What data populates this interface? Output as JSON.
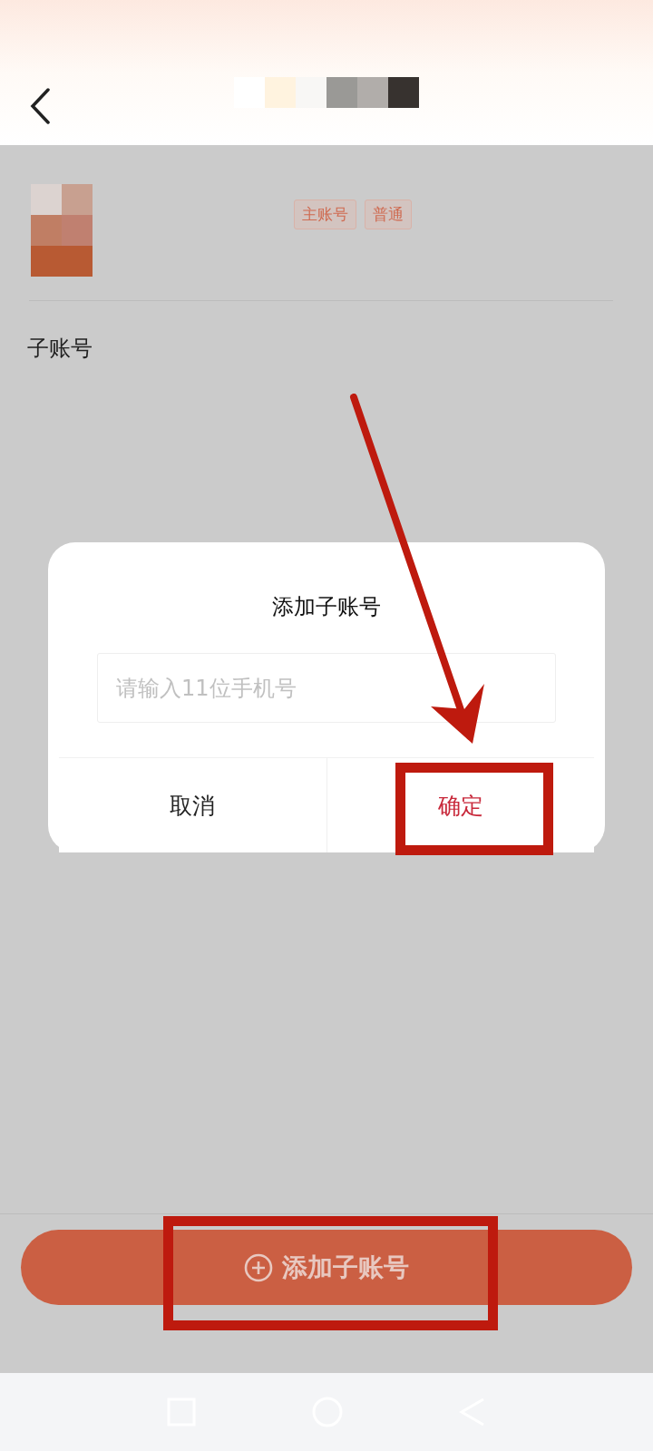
{
  "profile": {
    "tags": [
      "主账号",
      "普通"
    ]
  },
  "section_title": "子账号",
  "dialog": {
    "title": "添加子账号",
    "input": {
      "placeholder": "请输入11位手机号"
    },
    "buttons": [
      {
        "label": "取消",
        "kind": "cancel"
      },
      {
        "label": "确定",
        "kind": "confirm"
      }
    ]
  },
  "add_button": {
    "label": "添加子账号"
  }
}
